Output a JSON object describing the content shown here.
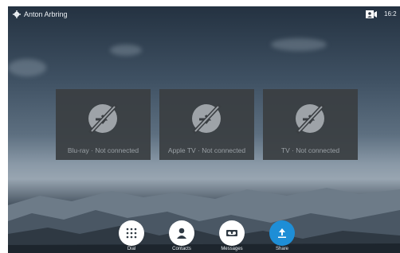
{
  "header": {
    "user_name": "Anton Arbring",
    "time": "16:2",
    "icons": [
      "settings-gear-icon",
      "camera-self-view-icon"
    ]
  },
  "sources": [
    {
      "label": "Blu-ray · Not connected",
      "icon": "not-connected-share-icon"
    },
    {
      "label": "Apple TV · Not connected",
      "icon": "not-connected-share-icon"
    },
    {
      "label": "TV · Not connected",
      "icon": "not-connected-share-icon"
    }
  ],
  "dock": [
    {
      "label": "Dial",
      "icon": "dialpad-icon",
      "accent": "#ffffff"
    },
    {
      "label": "Contacts",
      "icon": "contacts-person-icon",
      "accent": "#ffffff"
    },
    {
      "label": "Messages",
      "icon": "voicemail-icon",
      "accent": "#ffffff"
    },
    {
      "label": "Share",
      "icon": "share-upload-icon",
      "accent": "#1e8ed6"
    }
  ],
  "colors": {
    "tile_background": "#3a3e42",
    "tile_text": "#9aa0a5",
    "share_accent": "#1e8ed6"
  }
}
